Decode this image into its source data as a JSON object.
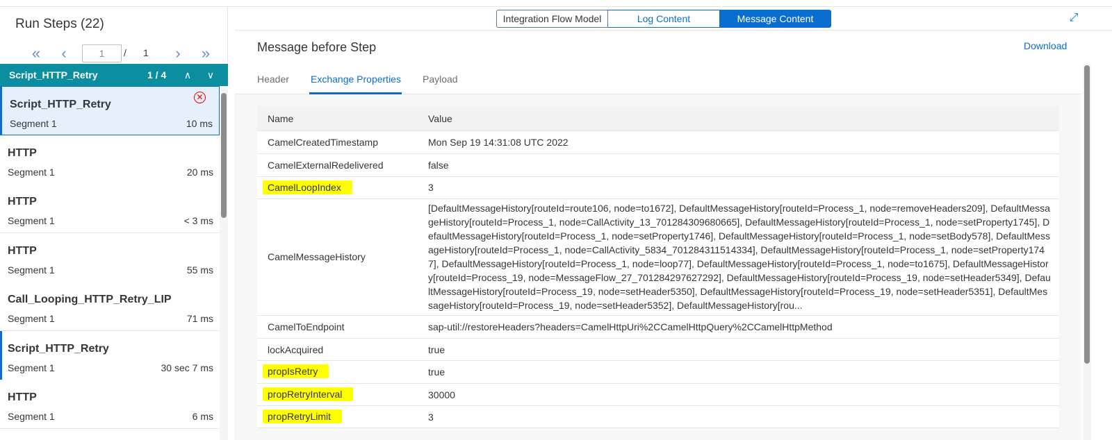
{
  "left": {
    "title": "Run Steps (22)",
    "pager": {
      "first": "«",
      "prev": "‹",
      "current": "1",
      "separator": "/",
      "total": "1",
      "next": "›",
      "last": "»"
    },
    "group": {
      "name": "Script_HTTP_Retry",
      "count": "1 / 4",
      "up": "∧",
      "down": "∨"
    },
    "steps": [
      {
        "name": "Script_HTTP_Retry",
        "segment": "Segment 1",
        "duration": "10 ms",
        "error_icon": "error-circle-icon"
      },
      {
        "name": "HTTP",
        "segment": "Segment 1",
        "duration": "20 ms"
      },
      {
        "name": "HTTP",
        "segment": "Segment 1",
        "duration": "< 3 ms"
      },
      {
        "name": "HTTP",
        "segment": "Segment 1",
        "duration": "55 ms"
      },
      {
        "name": "Call_Looping_HTTP_Retry_LIP",
        "segment": "Segment 1",
        "duration": "71 ms"
      },
      {
        "name": "Script_HTTP_Retry",
        "segment": "Segment 1",
        "duration": "30 sec 7 ms"
      },
      {
        "name": "HTTP",
        "segment": "Segment 1",
        "duration": "6 ms"
      }
    ]
  },
  "right": {
    "views": [
      "Integration Flow Model",
      "Log Content",
      "Message Content"
    ],
    "active_view": "Message Content",
    "fullscreen_icon": "⤢",
    "message_title": "Message before Step",
    "download_label": "Download",
    "tabs": [
      "Header",
      "Exchange Properties",
      "Payload"
    ],
    "active_tab": "Exchange Properties",
    "table": {
      "columns": [
        "Name",
        "Value"
      ],
      "rows": [
        {
          "name": "CamelCreatedTimestamp",
          "value": "Mon Sep 19 14:31:08 UTC 2022"
        },
        {
          "name": "CamelExternalRedelivered",
          "value": "false"
        },
        {
          "name": "CamelLoopIndex",
          "value": "3",
          "highlighted": true
        },
        {
          "name": "CamelMessageHistory",
          "value": "[DefaultMessageHistory[routeId=route106, node=to1672], DefaultMessageHistory[routeId=Process_1, node=removeHeaders209], DefaultMessageHistory[routeId=Process_1, node=CallActivity_13_701284309680665], DefaultMessageHistory[routeId=Process_1, node=setProperty1745], DefaultMessageHistory[routeId=Process_1, node=setProperty1746], DefaultMessageHistory[routeId=Process_1, node=setBody578], DefaultMessageHistory[routeId=Process_1, node=CallActivity_5834_701284311514334], DefaultMessageHistory[routeId=Process_1, node=setProperty1747], DefaultMessageHistory[routeId=Process_1, node=loop77], DefaultMessageHistory[routeId=Process_1, node=to1675], DefaultMessageHistory[routeId=Process_19, node=MessageFlow_27_701284297627292], DefaultMessageHistory[routeId=Process_19, node=setHeader5349], DefaultMessageHistory[routeId=Process_19, node=setHeader5350], DefaultMessageHistory[routeId=Process_19, node=setHeader5351], DefaultMessageHistory[routeId=Process_19, node=setHeader5352], DefaultMessageHistory[rou..."
        },
        {
          "name": "CamelToEndpoint",
          "value": "sap-util://restoreHeaders?headers=CamelHttpUri%2CCamelHttpQuery%2CCamelHttpMethod"
        },
        {
          "name": "lockAcquired",
          "value": "true"
        },
        {
          "name": "propIsRetry",
          "value": "true",
          "highlighted": true
        },
        {
          "name": "propRetryInterval",
          "value": "30000",
          "highlighted": true
        },
        {
          "name": "propRetryLimit",
          "value": "3",
          "highlighted": true
        }
      ]
    }
  },
  "colors": {
    "accent": "#0a6ed1",
    "group_bar": "#0a8ea0",
    "highlight": "#ffff00"
  }
}
